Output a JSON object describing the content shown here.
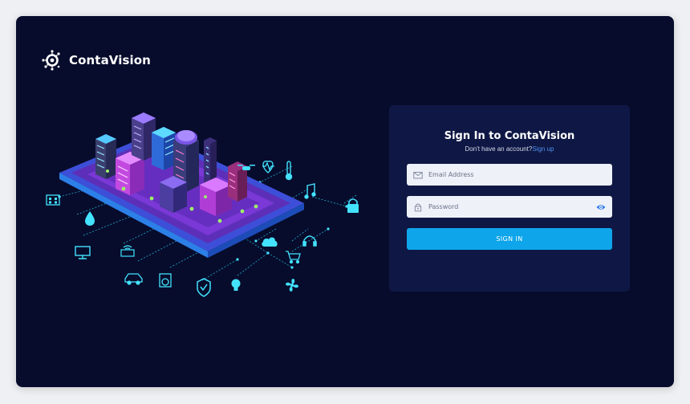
{
  "brand": {
    "name": "ContaVision",
    "logo_icon": "eye-logo-icon"
  },
  "colors": {
    "background": "#070c2c",
    "card": "#0f1845",
    "accent": "#0ea5ea",
    "link": "#4f8ff0"
  },
  "login": {
    "title": "Sign In to ContaVision",
    "subtitle_prefix": "Don't have an account?",
    "signup_link": "Sign up",
    "email": {
      "placeholder": "Email Address",
      "value": "",
      "icon": "envelope-icon"
    },
    "password": {
      "placeholder": "Password",
      "value": "",
      "icon": "lock-icon",
      "toggle_icon": "eye-icon"
    },
    "submit_label": "SIGN IN"
  },
  "illustration": {
    "label": "isometric smart city IoT illustration",
    "icons": [
      "building-grid-icon",
      "water-drop-icon",
      "monitor-icon",
      "wifi-router-icon",
      "car-icon",
      "washing-machine-icon",
      "shield-check-icon",
      "lightbulb-icon",
      "fan-icon",
      "shopping-cart-icon",
      "headphones-icon",
      "cloud-icon",
      "padlock-icon",
      "music-note-icon",
      "thermometer-icon",
      "heart-rate-icon",
      "drone-icon"
    ]
  }
}
